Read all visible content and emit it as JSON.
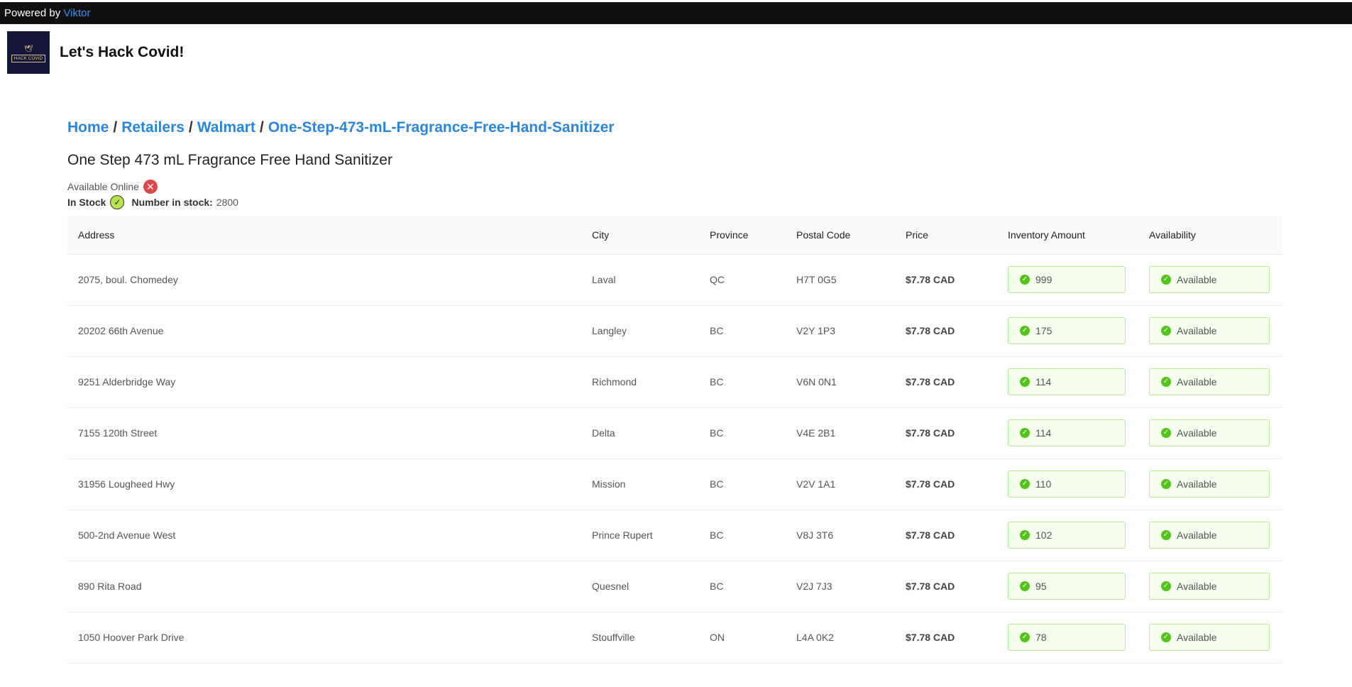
{
  "topbar": {
    "powered_by": "Powered by",
    "brand": "Viktor"
  },
  "header": {
    "logo_text": "HACK COVID",
    "site_title": "Let's Hack Covid!"
  },
  "breadcrumb": [
    "Home",
    "Retailers",
    "Walmart",
    "One-Step-473-mL-Fragrance-Free-Hand-Sanitizer"
  ],
  "product": {
    "title": "One Step 473 mL Fragrance Free Hand Sanitizer",
    "available_online_label": "Available Online",
    "in_stock_label": "In Stock",
    "number_in_stock_label": "Number in stock:",
    "number_in_stock": "2800"
  },
  "table": {
    "headers": [
      "Address",
      "City",
      "Province",
      "Postal Code",
      "Price",
      "Inventory Amount",
      "Availability"
    ],
    "rows": [
      {
        "address": "2075, boul. Chomedey",
        "city": "Laval",
        "province": "QC",
        "postal": "H7T 0G5",
        "price": "$7.78 CAD",
        "inventory": "999",
        "availability": "Available"
      },
      {
        "address": "20202 66th Avenue",
        "city": "Langley",
        "province": "BC",
        "postal": "V2Y 1P3",
        "price": "$7.78 CAD",
        "inventory": "175",
        "availability": "Available"
      },
      {
        "address": "9251 Alderbridge Way",
        "city": "Richmond",
        "province": "BC",
        "postal": "V6N 0N1",
        "price": "$7.78 CAD",
        "inventory": "114",
        "availability": "Available"
      },
      {
        "address": "7155 120th Street",
        "city": "Delta",
        "province": "BC",
        "postal": "V4E 2B1",
        "price": "$7.78 CAD",
        "inventory": "114",
        "availability": "Available"
      },
      {
        "address": "31956 Lougheed Hwy",
        "city": "Mission",
        "province": "BC",
        "postal": "V2V 1A1",
        "price": "$7.78 CAD",
        "inventory": "110",
        "availability": "Available"
      },
      {
        "address": "500-2nd Avenue West",
        "city": "Prince Rupert",
        "province": "BC",
        "postal": "V8J 3T6",
        "price": "$7.78 CAD",
        "inventory": "102",
        "availability": "Available"
      },
      {
        "address": "890 Rita Road",
        "city": "Quesnel",
        "province": "BC",
        "postal": "V2J 7J3",
        "price": "$7.78 CAD",
        "inventory": "95",
        "availability": "Available"
      },
      {
        "address": "1050 Hoover Park Drive",
        "city": "Stouffville",
        "province": "ON",
        "postal": "L4A 0K2",
        "price": "$7.78 CAD",
        "inventory": "78",
        "availability": "Available"
      }
    ]
  },
  "colors": {
    "brand_link": "#3d8ef0",
    "breadcrumb_link": "#2b86d9",
    "success": "#52c41a",
    "error": "#e04848"
  }
}
